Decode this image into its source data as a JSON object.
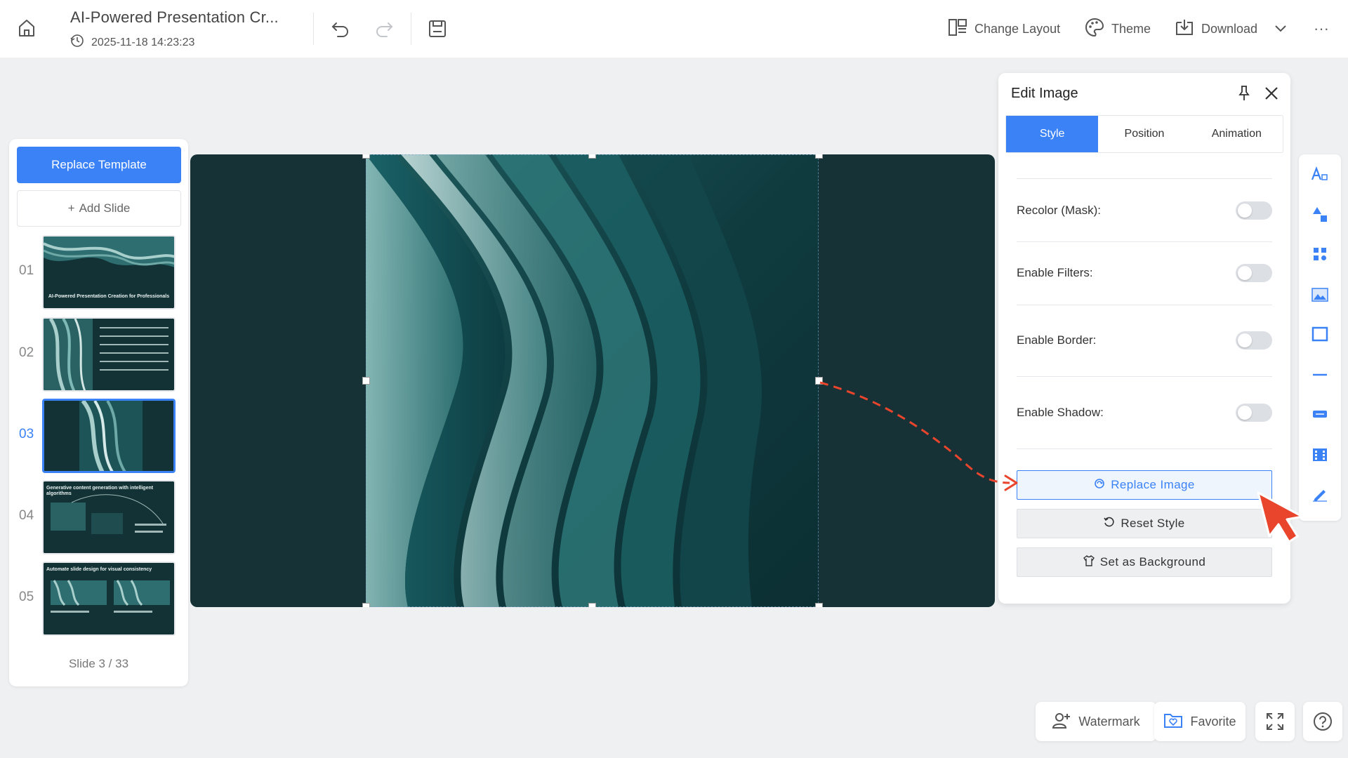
{
  "header": {
    "title": "AI-Powered Presentation Cr...",
    "timestamp": "2025-11-18 14:23:23",
    "change_layout": "Change Layout",
    "theme": "Theme",
    "download": "Download",
    "more": "···"
  },
  "sidebar": {
    "replace_template": "Replace Template",
    "add_slide": "Add Slide",
    "add_glyph": "+",
    "slides": [
      {
        "num": "01",
        "thumb_text": "AI-Powered Presentation Creation for Professionals"
      },
      {
        "num": "02",
        "thumb_text": ""
      },
      {
        "num": "03",
        "thumb_text": ""
      },
      {
        "num": "04",
        "thumb_text": "Generative content generation with intelligent algorithms"
      },
      {
        "num": "05",
        "thumb_text": "Automate slide design for visual consistency"
      }
    ],
    "active_slide": 3,
    "counter": "Slide 3 / 33"
  },
  "edit_panel": {
    "title": "Edit Image",
    "tabs": [
      "Style",
      "Position",
      "Animation"
    ],
    "active_tab": "Style",
    "options": [
      {
        "label": "Recolor (Mask):",
        "enabled": false
      },
      {
        "label": "Enable Filters:",
        "enabled": false
      },
      {
        "label": "Enable Border:",
        "enabled": false
      },
      {
        "label": "Enable Shadow:",
        "enabled": false
      }
    ],
    "replace_image": "Replace Image",
    "reset_style": "Reset Style",
    "set_background": "Set as Background"
  },
  "tool_rail": {
    "icons": [
      "text-icon",
      "shapes-icon",
      "elements-icon",
      "image-icon",
      "frame-icon",
      "line-icon",
      "textbox-icon",
      "video-icon",
      "draw-icon"
    ]
  },
  "bottom": {
    "watermark": "Watermark",
    "favorite": "Favorite"
  },
  "colors": {
    "accent": "#3b82f6",
    "canvas_bg": "#163236",
    "annotation": "#e8452c"
  },
  "collapse_glyph": "‹"
}
